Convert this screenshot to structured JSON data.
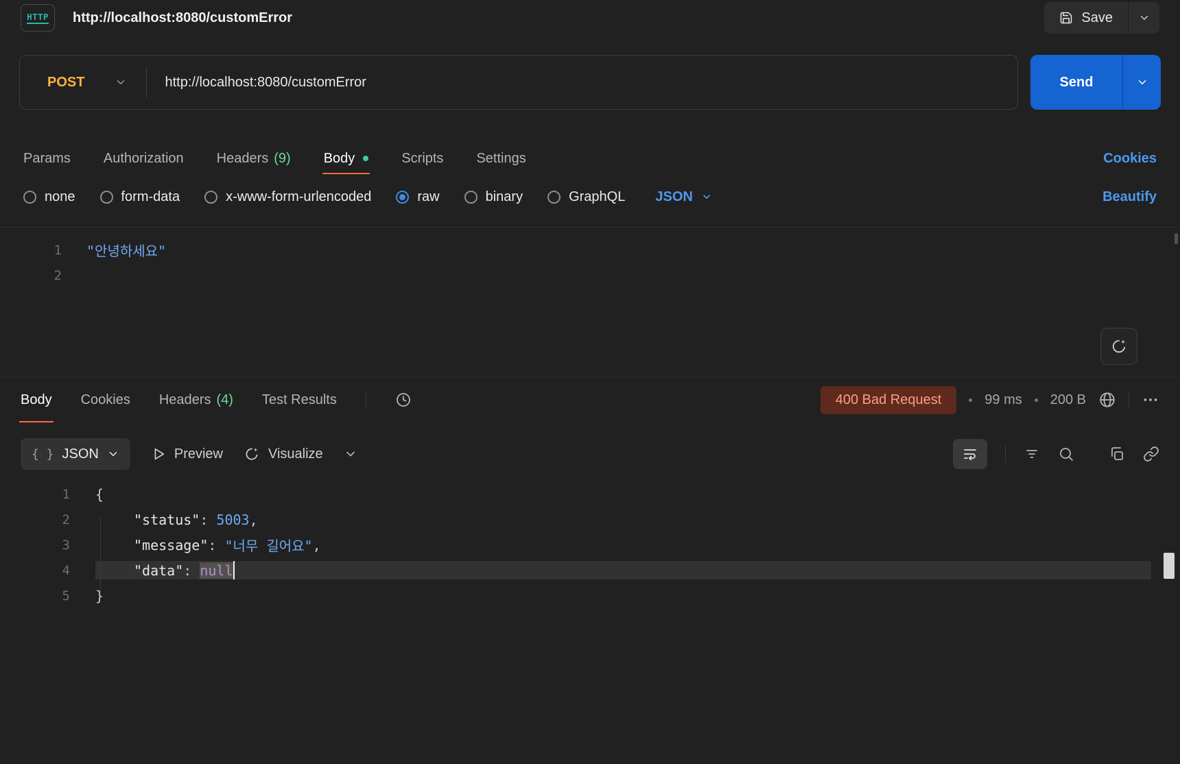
{
  "topbar": {
    "protocol_badge": "HTTP",
    "title": "http://localhost:8080/customError",
    "save_label": "Save"
  },
  "request": {
    "method": "POST",
    "url": "http://localhost:8080/customError",
    "send_label": "Send",
    "tabs": {
      "params": "Params",
      "authorization": "Authorization",
      "headers": "Headers",
      "headers_count": "(9)",
      "body": "Body",
      "scripts": "Scripts",
      "settings": "Settings"
    },
    "cookies_link": "Cookies",
    "body_types": {
      "none": "none",
      "form_data": "form-data",
      "urlencoded": "x-www-form-urlencoded",
      "raw": "raw",
      "binary": "binary",
      "graphql": "GraphQL"
    },
    "selected_body_type": "raw",
    "language": "JSON",
    "beautify_link": "Beautify",
    "editor": {
      "line1_number": "1",
      "line1_text": "\"안녕하세요\"",
      "line2_number": "2"
    }
  },
  "response": {
    "tabs": {
      "body": "Body",
      "cookies": "Cookies",
      "headers": "Headers",
      "headers_count": "(4)",
      "test_results": "Test Results"
    },
    "status": "400 Bad Request",
    "time": "99 ms",
    "size": "200 B",
    "toolbar": {
      "braces": "{ }",
      "format": "JSON",
      "preview": "Preview",
      "visualize": "Visualize"
    },
    "code": {
      "line1": {
        "num": "1",
        "open": "{"
      },
      "line2": {
        "num": "2",
        "key": "\"status\"",
        "sep": ": ",
        "value": "5003",
        "comma": ","
      },
      "line3": {
        "num": "3",
        "key": "\"message\"",
        "sep": ": ",
        "value": "\"너무 길어요\"",
        "comma": ","
      },
      "line4": {
        "num": "4",
        "key": "\"data\"",
        "sep": ": ",
        "value": "null"
      },
      "line5": {
        "num": "5",
        "close": "}"
      }
    }
  },
  "colors": {
    "accent_orange": "#ff6c37",
    "link_blue": "#4c9aef",
    "method_post_yellow": "#ffb43c",
    "send_button_blue": "#1663d2",
    "success_green": "#6bdd9a",
    "modified_dot_green": "#3ecf8e",
    "status_badge_bg": "#5e2a1d",
    "status_badge_text": "#ff9c87",
    "string_blue": "#6fa9f2",
    "null_purple": "#b48bd8",
    "badge_teal": "#2bb8a9"
  }
}
